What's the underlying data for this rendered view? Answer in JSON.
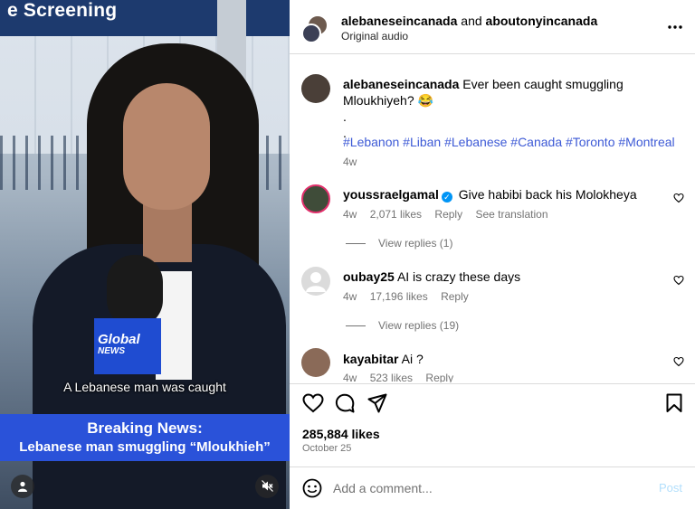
{
  "video": {
    "signage": "e Screening",
    "mic_brand": "Global",
    "mic_brand2": "NEWS",
    "caption": "A Lebanese man was caught",
    "breaking_line1": "Breaking News:",
    "breaking_line2": "Lebanese man smuggling “Mloukhieh”",
    "user_icon": "person-icon",
    "mute_icon": "mute-icon"
  },
  "header": {
    "author1": "alebaneseincanada",
    "joiner": " and ",
    "author2": "aboutonyincanada",
    "audio": "Original audio",
    "more_icon": "more-icon"
  },
  "post": {
    "username": "alebaneseincanada",
    "text": "Ever been caught smuggling Mloukhiyeh? 😂",
    "dot1": ".",
    "dot2": ".",
    "dot3": ".",
    "hashtags": "#Lebanon #Liban #Lebanese #Canada #Toronto #Montreal",
    "age": "4w"
  },
  "comments": [
    {
      "username": "youssraelgamal",
      "verified": true,
      "text": "Give habibi back his Molokheya",
      "age": "4w",
      "likes": "2,071 likes",
      "reply": "Reply",
      "translate": "See translation",
      "view_replies": "View replies (1)"
    },
    {
      "username": "oubay25",
      "text": "AI is crazy these days",
      "age": "4w",
      "likes": "17,196 likes",
      "reply": "Reply",
      "view_replies": "View replies (19)"
    },
    {
      "username": "kayabitar",
      "text": "Ai ?",
      "age": "4w",
      "likes": "523 likes",
      "reply": "Reply"
    }
  ],
  "actions": {
    "like_icon": "heart-icon",
    "comment_icon": "comment-icon",
    "share_icon": "share-icon",
    "save_icon": "bookmark-icon",
    "likes": "285,884 likes",
    "date": "October 25"
  },
  "composer": {
    "placeholder": "Add a comment...",
    "post_label": "Post",
    "emoji_icon": "emoji-icon"
  },
  "colors": {
    "hashtag": "#3d5ad6",
    "verified": "#0095f6",
    "breaking_banner": "#2a52d9",
    "post_disabled": "#b2dffc"
  }
}
